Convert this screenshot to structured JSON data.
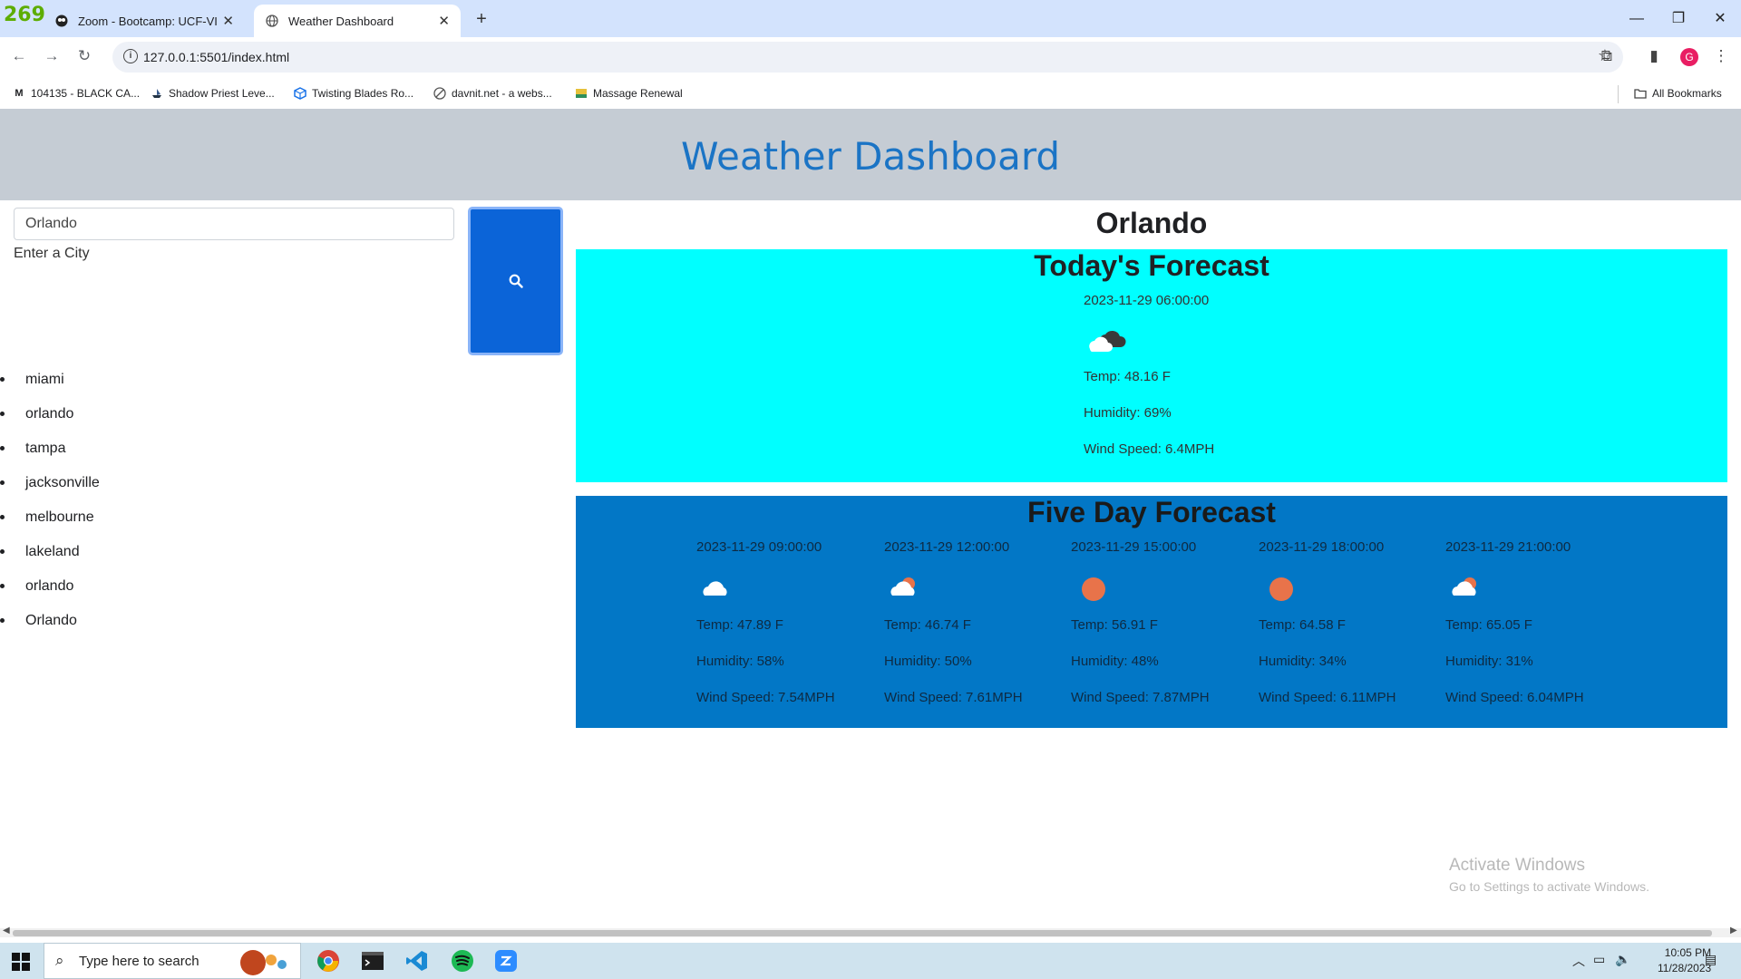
{
  "browser": {
    "tab_counter": "269",
    "tabs": [
      {
        "title": "Zoom - Bootcamp: UCF-VIRT-F",
        "active": false
      },
      {
        "title": "Weather Dashboard",
        "active": true
      }
    ],
    "url": "127.0.0.1:5501/index.html",
    "profile_initial": "G",
    "bookmarks": [
      {
        "label": "104135 - BLACK CA...",
        "icon": "m-icon"
      },
      {
        "label": "Shadow Priest Leve...",
        "icon": "ship-icon"
      },
      {
        "label": "Twisting Blades Ro...",
        "icon": "cube-icon"
      },
      {
        "label": "davnit.net - a webs...",
        "icon": "globe-icon"
      },
      {
        "label": "Massage Renewal",
        "icon": "massage-icon"
      }
    ],
    "all_bookmarks": "All Bookmarks"
  },
  "page": {
    "header_title": "Weather Dashboard",
    "search": {
      "value": "Orlando",
      "label": "Enter a City",
      "button_icon": "search-icon"
    },
    "history": [
      "miami",
      "orlando",
      "tampa",
      "jacksonville",
      "melbourne",
      "lakeland",
      "orlando",
      "Orlando"
    ],
    "city": "Orlando",
    "today": {
      "title": "Today's Forecast",
      "date": "2023-11-29 06:00:00",
      "icon": "broken-clouds-icon",
      "temp": "Temp: 48.16 F",
      "humidity": "Humidity: 69%",
      "wind": "Wind Speed: 6.4MPH"
    },
    "five_day": {
      "title": "Five Day Forecast",
      "days": [
        {
          "date": "2023-11-29 09:00:00",
          "icon": "cloud-icon",
          "temp": "Temp: 47.89 F",
          "humidity": "Humidity: 58%",
          "wind": "Wind Speed: 7.54MPH"
        },
        {
          "date": "2023-11-29 12:00:00",
          "icon": "partly-cloudy-icon",
          "temp": "Temp: 46.74 F",
          "humidity": "Humidity: 50%",
          "wind": "Wind Speed: 7.61MPH"
        },
        {
          "date": "2023-11-29 15:00:00",
          "icon": "sun-icon",
          "temp": "Temp: 56.91 F",
          "humidity": "Humidity: 48%",
          "wind": "Wind Speed: 7.87MPH"
        },
        {
          "date": "2023-11-29 18:00:00",
          "icon": "sun-icon",
          "temp": "Temp: 64.58 F",
          "humidity": "Humidity: 34%",
          "wind": "Wind Speed: 6.11MPH"
        },
        {
          "date": "2023-11-29 21:00:00",
          "icon": "partly-cloudy-icon",
          "temp": "Temp: 65.05 F",
          "humidity": "Humidity: 31%",
          "wind": "Wind Speed: 6.04MPH"
        }
      ]
    }
  },
  "watermark": {
    "line1": "Activate Windows",
    "line2": "Go to Settings to activate Windows."
  },
  "taskbar": {
    "search_placeholder": "Type here to search",
    "apps": [
      "chrome-icon",
      "terminal-icon",
      "vscode-icon",
      "spotify-icon",
      "zoom-icon"
    ],
    "time": "10:05 PM",
    "date": "11/28/2023"
  },
  "colors": {
    "header_bg": "#c5ccd4",
    "header_title": "#1b74c5",
    "today_bg": "#00ffff",
    "five_day_bg": "#0277c6",
    "search_button": "#0b64d8",
    "sun": "#e8734a"
  }
}
